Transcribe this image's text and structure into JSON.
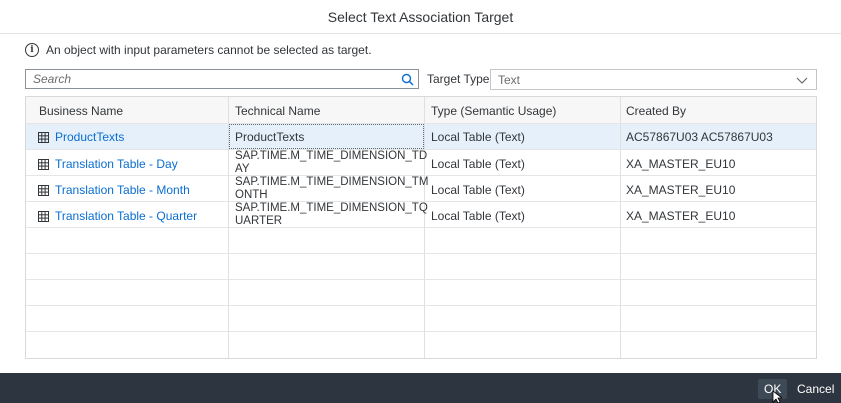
{
  "dialog": {
    "title": "Select Text Association Target",
    "info_text": "An object with input parameters cannot be selected as target."
  },
  "filter": {
    "search_placeholder": "Search",
    "target_type_label": "Target Type",
    "target_type_value": "Text"
  },
  "table": {
    "columns": [
      "Business Name",
      "Technical Name",
      "Type (Semantic Usage)",
      "Created By"
    ],
    "rows": [
      {
        "business_name": "ProductTexts",
        "technical_name_1": "ProductTexts",
        "technical_name_2": "",
        "type": "Local Table (Text)",
        "created_by": "AC57867U03 AC57867U03",
        "selected": true
      },
      {
        "business_name": "Translation Table - Day",
        "technical_name_1": "SAP.TIME.M_TIME_DIMENSION_TD",
        "technical_name_2": "AY",
        "type": "Local Table (Text)",
        "created_by": "XA_MASTER_EU10",
        "selected": false
      },
      {
        "business_name": "Translation Table - Month",
        "technical_name_1": "SAP.TIME.M_TIME_DIMENSION_TM",
        "technical_name_2": "ONTH",
        "type": "Local Table (Text)",
        "created_by": "XA_MASTER_EU10",
        "selected": false
      },
      {
        "business_name": "Translation Table - Quarter",
        "technical_name_1": "SAP.TIME.M_TIME_DIMENSION_TQ",
        "technical_name_2": "UARTER",
        "type": "Local Table (Text)",
        "created_by": "XA_MASTER_EU10",
        "selected": false
      }
    ],
    "row_icon": "table-icon"
  },
  "footer": {
    "ok_label": "OK",
    "cancel_label": "Cancel"
  },
  "colors": {
    "accent": "#0a6ed1",
    "selection": "#e5f0fa",
    "footer_bg": "#2d3540"
  }
}
